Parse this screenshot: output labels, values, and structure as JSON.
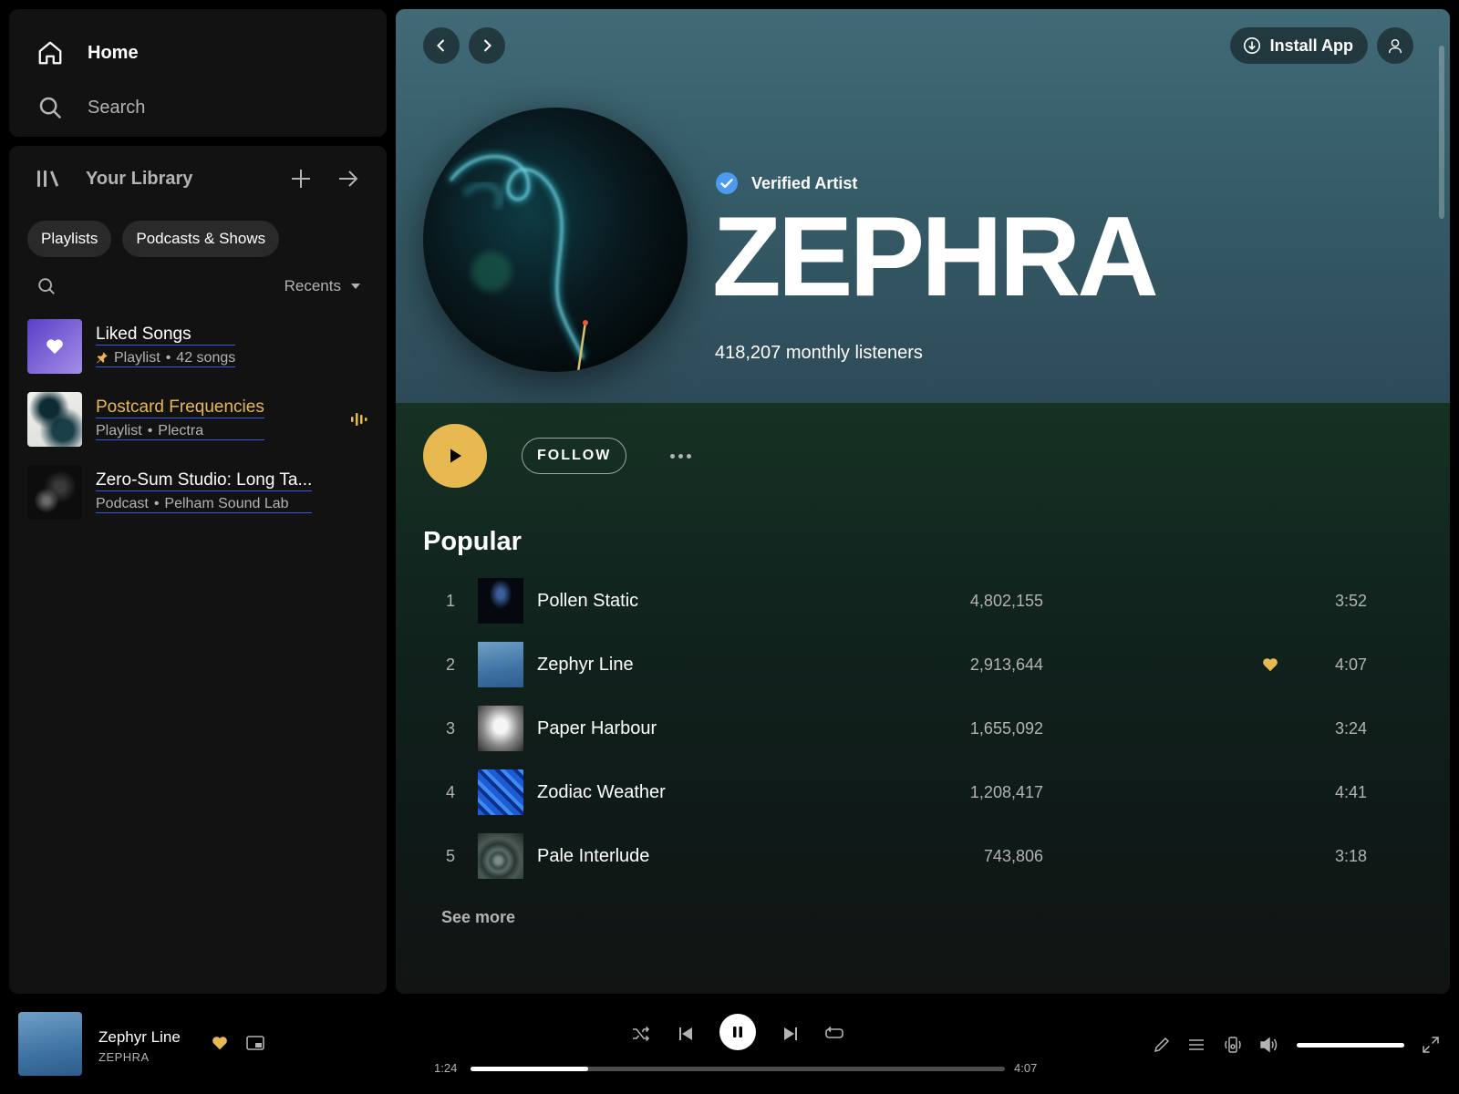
{
  "nav": {
    "home": "Home",
    "search": "Search"
  },
  "library": {
    "title": "Your Library",
    "chips": [
      "Playlists",
      "Podcasts & Shows"
    ],
    "sort": "Recents",
    "items": [
      {
        "title": "Liked Songs",
        "type": "Playlist",
        "meta": "42 songs",
        "pinned": true,
        "playing": false
      },
      {
        "title": "Postcard Frequencies",
        "type": "Playlist",
        "meta": "Plectra",
        "pinned": false,
        "playing": true
      },
      {
        "title": "Zero-Sum Studio: Long Ta...",
        "type": "Podcast",
        "meta": "Pelham Sound Lab",
        "pinned": false,
        "playing": false
      }
    ]
  },
  "header": {
    "install_label": "Install App"
  },
  "artist": {
    "verified_label": "Verified Artist",
    "name": "ZEPHRA",
    "listeners": "418,207 monthly listeners",
    "follow_label": "FOLLOW"
  },
  "popular": {
    "title": "Popular",
    "tracks": [
      {
        "num": "1",
        "name": "Pollen Static",
        "plays": "4,802,155",
        "liked": false,
        "duration": "3:52"
      },
      {
        "num": "2",
        "name": "Zephyr Line",
        "plays": "2,913,644",
        "liked": true,
        "duration": "4:07"
      },
      {
        "num": "3",
        "name": "Paper Harbour",
        "plays": "1,655,092",
        "liked": false,
        "duration": "3:24"
      },
      {
        "num": "4",
        "name": "Zodiac Weather",
        "plays": "1,208,417",
        "liked": false,
        "duration": "4:41"
      },
      {
        "num": "5",
        "name": "Pale Interlude",
        "plays": "743,806",
        "liked": false,
        "duration": "3:18"
      }
    ],
    "see_more": "See more"
  },
  "player": {
    "title": "Zephyr Line",
    "artist": "ZEPHRA",
    "elapsed": "1:24",
    "total": "4:07",
    "progress": 0.22,
    "volume": 1.0,
    "liked": true
  },
  "colors": {
    "accent": "#e8b951",
    "link_underline": "#3a55e0"
  }
}
